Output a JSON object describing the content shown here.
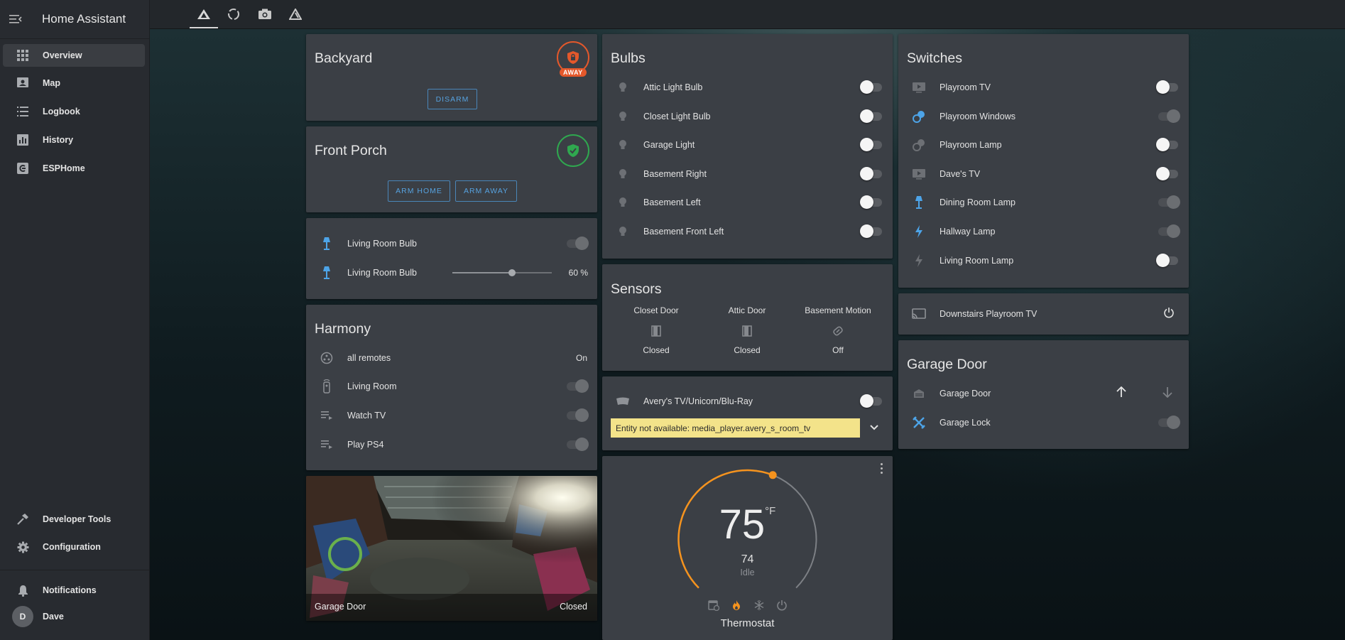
{
  "app_title": "Home Assistant",
  "sidebar": {
    "items": [
      {
        "label": "Overview",
        "icon": "grid-icon"
      },
      {
        "label": "Map",
        "icon": "map-icon"
      },
      {
        "label": "Logbook",
        "icon": "list-icon"
      },
      {
        "label": "History",
        "icon": "chart-icon"
      },
      {
        "label": "ESPHome",
        "icon": "esphome-icon"
      }
    ],
    "bottom_items": [
      {
        "label": "Developer Tools",
        "icon": "hammer-icon"
      },
      {
        "label": "Configuration",
        "icon": "gear-icon"
      }
    ],
    "notifications_label": "Notifications",
    "user": {
      "initial": "D",
      "name": "Dave"
    }
  },
  "tabs": [
    {
      "name": "home-tab",
      "icon": "triangle-logo-icon"
    },
    {
      "name": "ring-tab",
      "icon": "circle-icon"
    },
    {
      "name": "camera-tab",
      "icon": "camera-icon"
    },
    {
      "name": "network-tab",
      "icon": "triangle-outline-icon"
    }
  ],
  "backyard": {
    "title": "Backyard",
    "badge": "AWAY",
    "button": "DISARM"
  },
  "front_porch": {
    "title": "Front Porch",
    "buttons": [
      "ARM HOME",
      "ARM AWAY"
    ]
  },
  "living_room": {
    "rows": [
      {
        "name": "Living Room Bulb",
        "state": "toggle"
      },
      {
        "name": "Living Room Bulb",
        "value": "60 %"
      }
    ],
    "brightness": 0.6
  },
  "harmony": {
    "title": "Harmony",
    "rows": [
      {
        "name": "all remotes",
        "value": "On"
      },
      {
        "name": "Living Room"
      },
      {
        "name": "Watch TV"
      },
      {
        "name": "Play PS4"
      }
    ]
  },
  "camera": {
    "name": "Garage Door",
    "state": "Closed"
  },
  "bulbs": {
    "title": "Bulbs",
    "items": [
      "Attic Light Bulb",
      "Closet Light Bulb",
      "Garage Light",
      "Basement Right",
      "Basement Left",
      "Basement Front Left"
    ]
  },
  "sensors": {
    "title": "Sensors",
    "items": [
      {
        "name": "Closet Door",
        "state": "Closed",
        "icon": "door-closed-icon"
      },
      {
        "name": "Attic Door",
        "state": "Closed",
        "icon": "door-closed-icon"
      },
      {
        "name": "Basement Motion",
        "state": "Off",
        "icon": "motion-sensor-icon"
      }
    ]
  },
  "media": {
    "name": "Avery's TV/Unicorn/Blu-Ray",
    "warning": "Entity not available: media_player.avery_s_room_tv"
  },
  "thermostat": {
    "temperature": "75",
    "unit": "°F",
    "current": "74",
    "status": "Idle",
    "name": "Thermostat",
    "setpoint_fraction": 0.58,
    "accent": "#f5931e"
  },
  "switches": {
    "title": "Switches",
    "items": [
      {
        "name": "Playroom TV",
        "icon": "tv-icon"
      },
      {
        "name": "Playroom Windows",
        "icon": "windows-icon"
      },
      {
        "name": "Playroom Lamp",
        "icon": "lamp-icon"
      },
      {
        "name": "Dave's TV",
        "icon": "tv-icon"
      },
      {
        "name": "Dining Room Lamp",
        "icon": "floor-lamp-icon"
      },
      {
        "name": "Hallway Lamp",
        "icon": "flash-icon"
      },
      {
        "name": "Living Room Lamp",
        "icon": "flash-icon"
      }
    ]
  },
  "downstairs": {
    "name": "Downstairs Playroom TV"
  },
  "garage": {
    "title": "Garage Door",
    "rows": [
      {
        "name": "Garage Door"
      },
      {
        "name": "Garage Lock"
      }
    ]
  },
  "colors": {
    "accent_blue": "#4da4e8",
    "away_orange": "#e4582b",
    "armed_green": "#2fa84f",
    "warning_yellow": "#f3e38a"
  }
}
